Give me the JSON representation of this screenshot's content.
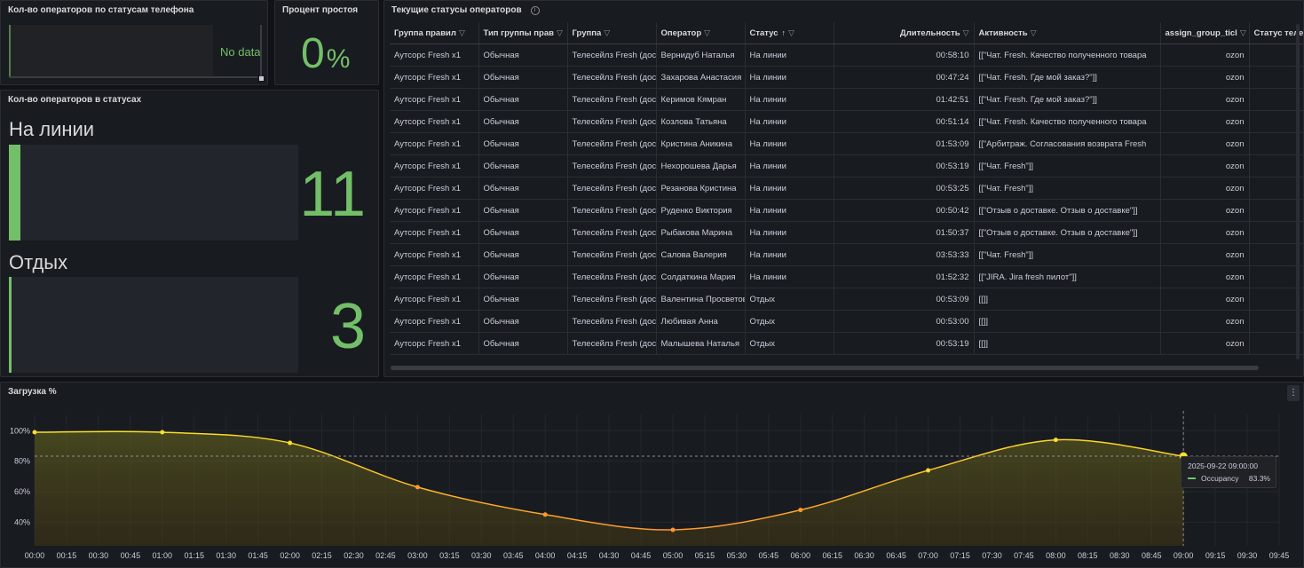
{
  "panels": {
    "phone_status": {
      "title": "Кол-во операторов по статусам телефона",
      "no_data": "No data"
    },
    "idle_percent": {
      "title": "Процент простоя",
      "value": "0",
      "unit": "%"
    },
    "status_counts": {
      "title": "Кол-во операторов в статусах",
      "items": [
        {
          "label": "На линии",
          "value": "11",
          "fill_fraction": 0.04
        },
        {
          "label": "Отдых",
          "value": "3",
          "fill_fraction": 0.01
        }
      ]
    },
    "current_statuses": {
      "title": "Текущие статусы операторов",
      "columns": [
        "Группа правил",
        "Тип группы прав",
        "Группа",
        "Оператор",
        "Статус",
        "Длительность",
        "Активность",
        "assign_group_ticl",
        "Статус телефона"
      ],
      "sorted_column": "Статус",
      "rows": [
        [
          "Аутсорс Fresh x1",
          "Обычная",
          "Телесейлз Fresh (доставка)",
          "Вернидуб Наталья",
          "На линии",
          "00:58:10",
          "[[\"Чат. Fresh. Качество полученного товара",
          "ozon",
          ""
        ],
        [
          "Аутсорс Fresh x1",
          "Обычная",
          "Телесейлз Fresh (доставка)",
          "Захарова Анастасия",
          "На линии",
          "00:47:24",
          "[[\"Чат. Fresh. Где мой заказ?\"]]",
          "ozon",
          ""
        ],
        [
          "Аутсорс Fresh x1",
          "Обычная",
          "Телесейлз Fresh (доставка)",
          "Керимов Кямран",
          "На линии",
          "01:42:51",
          "[[\"Чат. Fresh. Где мой заказ?\"]]",
          "ozon",
          ""
        ],
        [
          "Аутсорс Fresh x1",
          "Обычная",
          "Телесейлз Fresh (доставка)",
          "Козлова Татьяна",
          "На линии",
          "00:51:14",
          "[[\"Чат. Fresh. Качество полученного товара",
          "ozon",
          ""
        ],
        [
          "Аутсорс Fresh x1",
          "Обычная",
          "Телесейлз Fresh (доставка)",
          "Кристина Аникина",
          "На линии",
          "01:53:09",
          "[[\"Арбитраж. Согласования возврата Fresh",
          "ozon",
          ""
        ],
        [
          "Аутсорс Fresh x1",
          "Обычная",
          "Телесейлз Fresh (доставка)",
          "Нехорошева Дарья",
          "На линии",
          "00:53:19",
          "[[\"Чат. Fresh\"]]",
          "ozon",
          ""
        ],
        [
          "Аутсорс Fresh x1",
          "Обычная",
          "Телесейлз Fresh (доставка)",
          "Резанова Кристина",
          "На линии",
          "00:53:25",
          "[[\"Чат. Fresh\"]]",
          "ozon",
          ""
        ],
        [
          "Аутсорс Fresh x1",
          "Обычная",
          "Телесейлз Fresh (доставка)",
          "Руденко Виктория",
          "На линии",
          "00:50:42",
          "[[\"Отзыв о доставке. Отзыв о доставке\"]]",
          "ozon",
          ""
        ],
        [
          "Аутсорс Fresh x1",
          "Обычная",
          "Телесейлз Fresh (доставка)",
          "Рыбакова Марина",
          "На линии",
          "01:50:37",
          "[[\"Отзыв о доставке. Отзыв о доставке\"]]",
          "ozon",
          ""
        ],
        [
          "Аутсорс Fresh x1",
          "Обычная",
          "Телесейлз Fresh (доставка)",
          "Салова Валерия",
          "На линии",
          "03:53:33",
          "[[\"Чат. Fresh\"]]",
          "ozon",
          ""
        ],
        [
          "Аутсорс Fresh x1",
          "Обычная",
          "Телесейлз Fresh (доставка)",
          "Солдаткина Мария",
          "На линии",
          "01:52:32",
          "[[\"JIRA. Jira fresh пилот\"]]",
          "ozon",
          ""
        ],
        [
          "Аутсорс Fresh x1",
          "Обычная",
          "Телесейлз Fresh (доставка)",
          "Валентина Просветова",
          "Отдых",
          "00:53:09",
          "[[]]",
          "ozon",
          ""
        ],
        [
          "Аутсорс Fresh x1",
          "Обычная",
          "Телесейлз Fresh (доставка)",
          "Любивая Анна",
          "Отдых",
          "00:53:00",
          "[[]]",
          "ozon",
          ""
        ],
        [
          "Аутсорс Fresh x1",
          "Обычная",
          "Телесейлз Fresh (доставка)",
          "Малышева Наталья",
          "Отдых",
          "00:53:19",
          "[[]]",
          "ozon",
          ""
        ]
      ]
    },
    "load": {
      "title": "Загрузка %",
      "menu_icon": "kebab-icon",
      "tooltip": {
        "time": "2025-09-22 09:00:00",
        "series": "Occupancy",
        "value": "83.3%"
      }
    }
  },
  "colors": {
    "accent_green": "#73bf69",
    "line_yellow": "#fade2a",
    "line_orange": "#ff9830"
  },
  "chart_data": {
    "type": "line",
    "title": "Загрузка %",
    "series": [
      {
        "name": "Occupancy",
        "x": [
          "00:00",
          "01:00",
          "02:00",
          "03:00",
          "04:00",
          "05:00",
          "06:00",
          "07:00",
          "08:00",
          "09:00"
        ],
        "values": [
          99,
          99,
          92,
          63,
          45,
          35,
          48,
          74,
          94,
          83.3
        ]
      }
    ],
    "x_ticks": [
      "00:00",
      "00:15",
      "00:30",
      "00:45",
      "01:00",
      "01:15",
      "01:30",
      "01:45",
      "02:00",
      "02:15",
      "02:30",
      "02:45",
      "03:00",
      "03:15",
      "03:30",
      "03:45",
      "04:00",
      "04:15",
      "04:30",
      "04:45",
      "05:00",
      "05:15",
      "05:30",
      "05:45",
      "06:00",
      "06:15",
      "06:30",
      "06:45",
      "07:00",
      "07:15",
      "07:30",
      "07:45",
      "08:00",
      "08:15",
      "08:30",
      "08:45",
      "09:00",
      "09:15",
      "09:30",
      "09:45"
    ],
    "y_ticks": [
      "100%",
      "80%",
      "60%",
      "40%"
    ],
    "ylim": [
      28,
      106
    ],
    "xlim_minutes": [
      0,
      585
    ],
    "grid": true,
    "hover_x": "09:00",
    "hover_value": 83.3
  }
}
